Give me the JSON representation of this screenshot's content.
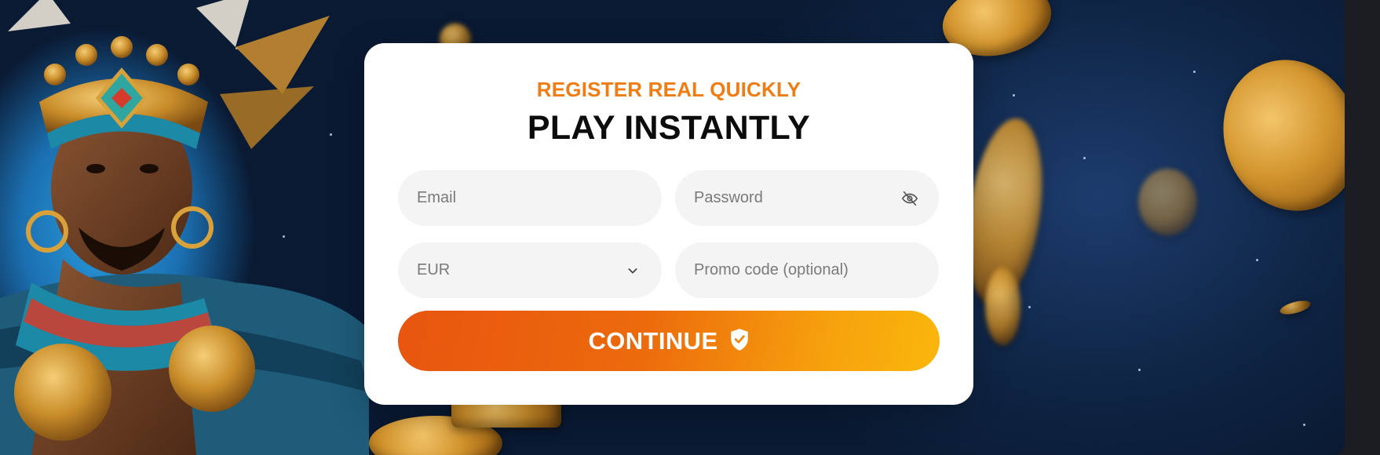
{
  "signup": {
    "eyebrow": "REGISTER REAL QUICKLY",
    "headline": "PLAY INSTANTLY",
    "email": {
      "placeholder": "Email"
    },
    "password": {
      "placeholder": "Password",
      "visibility_icon": "eye-off-icon"
    },
    "currency": {
      "selected": "EUR",
      "icon": "chevron-down-icon"
    },
    "promo": {
      "placeholder": "Promo code (optional)"
    },
    "continue_label": "CONTINUE",
    "continue_icon": "shield-check-icon"
  },
  "colors": {
    "accent_orange": "#f07c14",
    "button_gradient_start": "#e8550f",
    "button_gradient_end": "#fab60c",
    "field_background": "#f4f4f4"
  }
}
